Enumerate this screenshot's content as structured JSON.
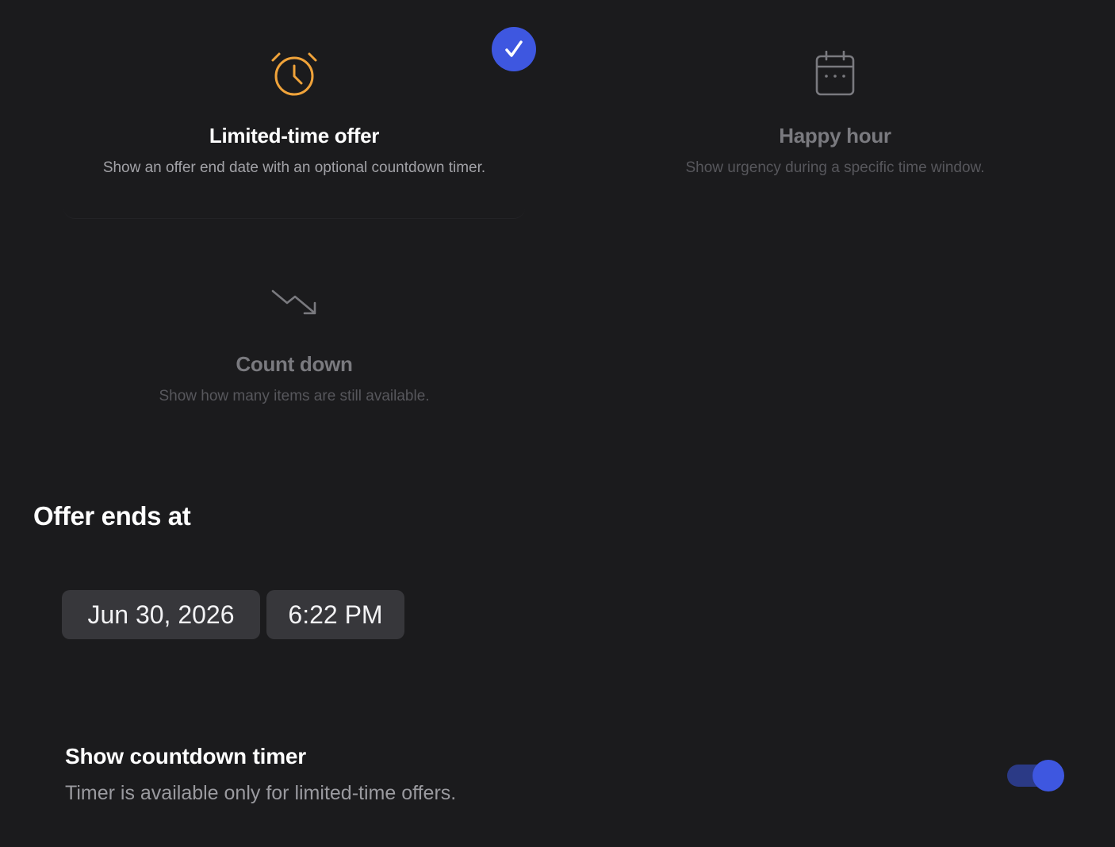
{
  "colors": {
    "background": "#1b1b1d",
    "accent": "#3e57e0",
    "offer_icon": "#f0a33a",
    "muted_icon": "#7a7a7f",
    "pill_bg": "#37373b"
  },
  "offer_types": [
    {
      "id": "limited-time-offer",
      "icon": "alarm-clock-icon",
      "title": "Limited-time offer",
      "description": "Show an offer end date with an optional countdown timer.",
      "selected": true
    },
    {
      "id": "happy-hour",
      "icon": "calendar-icon",
      "title": "Happy hour",
      "description": "Show urgency during a specific time window.",
      "selected": false
    },
    {
      "id": "count-down",
      "icon": "trend-down-icon",
      "title": "Count down",
      "description": "Show how many items are still available.",
      "selected": false
    }
  ],
  "selected_badge_icon": "checkmark-icon",
  "offer_end": {
    "heading": "Offer ends at",
    "date": "Jun 30, 2026",
    "time": "6:22 PM"
  },
  "countdown_timer": {
    "title": "Show countdown timer",
    "description": "Timer is available only for limited-time offers.",
    "enabled": true
  }
}
